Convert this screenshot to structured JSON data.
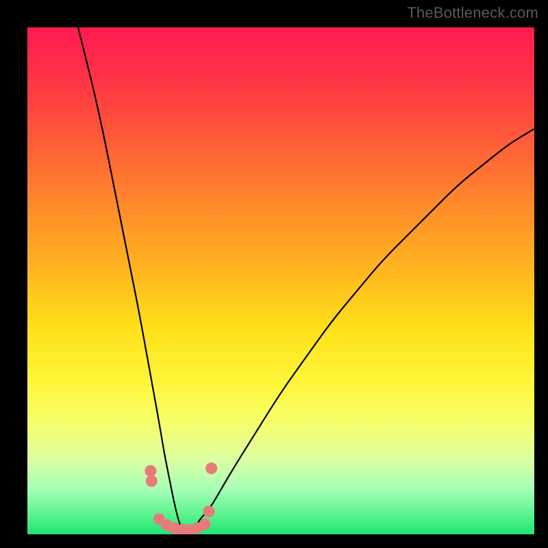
{
  "watermark": "TheBottleneck.com",
  "chart_data": {
    "type": "line",
    "title": "",
    "xlabel": "",
    "ylabel": "",
    "xlim": [
      0,
      100
    ],
    "ylim": [
      0,
      100
    ],
    "grid": false,
    "legend": false,
    "notes": "Background is a vertical color gradient from green (bottom, value=0) through yellow/orange to red (top, value=100). The curve is a V-shape (bottleneck curve) with the minimum near x≈31, y≈0. Pink dot markers cluster around the trough. No numeric axis labels are shown.",
    "series": [
      {
        "name": "bottleneck-curve",
        "x": [
          10,
          14,
          18,
          20,
          22,
          24,
          26,
          27,
          28,
          29,
          30,
          31,
          32,
          33,
          34,
          36,
          40,
          45,
          50,
          55,
          60,
          65,
          70,
          75,
          80,
          85,
          90,
          95,
          100
        ],
        "values": [
          100,
          84,
          64,
          54,
          44,
          33,
          22,
          16,
          11,
          6,
          2,
          0,
          0,
          1,
          3,
          5,
          12,
          20,
          28,
          35,
          42,
          48,
          54,
          59,
          64,
          69,
          73,
          77,
          80
        ]
      },
      {
        "name": "marker-dots",
        "type": "scatter",
        "color": "#e77a7a",
        "x": [
          24.3,
          24.5,
          26.0,
          27.5,
          29.0,
          30.5,
          32.0,
          33.5,
          35.0,
          35.8,
          36.3
        ],
        "values": [
          12.5,
          10.5,
          3.0,
          1.8,
          1.2,
          0.9,
          0.9,
          1.2,
          2.0,
          4.5,
          13.0
        ]
      }
    ]
  }
}
